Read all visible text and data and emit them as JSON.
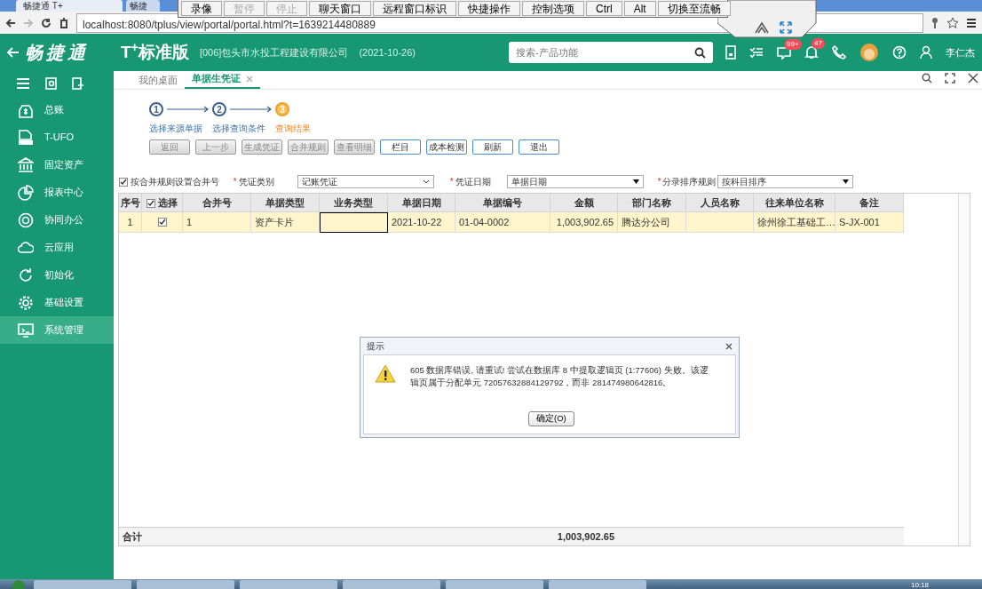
{
  "browser": {
    "tabs": [
      {
        "title": "畅捷通 T+",
        "selected": true
      },
      {
        "title": "畅捷",
        "selected": false
      }
    ],
    "address": "localhost:8080/tplus/view/portal/portal.html?t=1639214480889"
  },
  "remote_toolbar": {
    "buttons": [
      {
        "label": "录像",
        "disabled": false
      },
      {
        "label": "暂停",
        "disabled": true
      },
      {
        "label": "停止",
        "disabled": true
      },
      {
        "label": "聊天窗口",
        "disabled": false
      },
      {
        "label": "远程窗口标识",
        "disabled": false
      },
      {
        "label": "快捷操作",
        "disabled": false
      },
      {
        "label": "控制选项",
        "disabled": false
      },
      {
        "label": "Ctrl",
        "disabled": false
      },
      {
        "label": "Alt",
        "disabled": false
      },
      {
        "label": "切换至流畅",
        "disabled": false
      }
    ]
  },
  "header": {
    "brand": "畅捷通",
    "edition": "T$^{+}$标准版",
    "company": "[006]包头市水投工程建设有限公司",
    "date": "(2021-10-26)",
    "search": {
      "placeholder": "搜索-产品功能"
    },
    "message_badge": "99+",
    "notification_badge": "47",
    "user": "李仁杰"
  },
  "sidebar": {
    "items": [
      {
        "label": "总账",
        "selected": false
      },
      {
        "label": "T-UFO",
        "selected": false
      },
      {
        "label": "固定资产",
        "selected": false
      },
      {
        "label": "报表中心",
        "selected": false
      },
      {
        "label": "协同办公",
        "selected": false
      },
      {
        "label": "云应用",
        "selected": false
      },
      {
        "label": "初始化",
        "selected": false
      },
      {
        "label": "基础设置",
        "selected": false
      },
      {
        "label": "系统管理",
        "selected": true
      }
    ]
  },
  "page_tabs": [
    {
      "label": "我的桌面",
      "selected": false,
      "closable": false
    },
    {
      "label": "单据生凭证",
      "selected": true,
      "closable": true
    }
  ],
  "steps": [
    {
      "number": "1",
      "label": "选择来源单据",
      "current": false
    },
    {
      "number": "2",
      "label": "选择查询条件",
      "current": false
    },
    {
      "number": "3",
      "label": "查询结果",
      "current": true
    }
  ],
  "actions": [
    {
      "label": "返回",
      "disabled": true
    },
    {
      "label": "上一步",
      "disabled": true
    },
    {
      "label": "生成凭证",
      "disabled": true
    },
    {
      "label": "合并规则",
      "disabled": true
    },
    {
      "label": "查看明细",
      "disabled": true
    },
    {
      "label": "栏目",
      "disabled": false
    },
    {
      "label": "成本检测",
      "disabled": false
    },
    {
      "label": "刷新",
      "disabled": false
    },
    {
      "label": "退出",
      "disabled": false
    }
  ],
  "filters": {
    "merge_option": {
      "label": "按合并规则设置合并号",
      "checked": true
    },
    "selects": [
      {
        "mark": "*",
        "label": "凭证类别",
        "value": "记账凭证",
        "kind": "native"
      },
      {
        "mark": "*",
        "label": "凭证日期",
        "value": "单据日期",
        "kind": "combo"
      },
      {
        "mark": "*",
        "label": "分录排序规则",
        "value": "按科目排序",
        "kind": "combo"
      }
    ]
  },
  "table": {
    "columns": [
      "序号",
      "选择",
      "合并号",
      "单据类型",
      "业务类型",
      "单据日期",
      "单据编号",
      "金额",
      "部门名称",
      "人员名称",
      "往来单位名称",
      "备注"
    ],
    "select_all": true,
    "rows": [
      {
        "seq": "1",
        "selected": true,
        "merge_no": "1",
        "doc_type": "资产卡片",
        "business_type_focused": true,
        "doc_date": "2021-10-22",
        "doc_no": "01-04-0002",
        "amount": "1,003,902.65",
        "department": "腾达分公司",
        "partner": "徐州徐工基础工…",
        "remark": "S-JX-001"
      }
    ],
    "total": {
      "label": "合计",
      "amount": "1,003,902.65"
    }
  },
  "dialog": {
    "title": "提示",
    "message": "605 数据库错误, 请重试! 尝试在数据库 8 中提取逻辑页 (1:77606) 失败。该逻辑页属于分配单元 72057632884129792，而非 281474980642816。",
    "button": "确定(O)"
  },
  "taskbar": {
    "clock": "10:18"
  }
}
